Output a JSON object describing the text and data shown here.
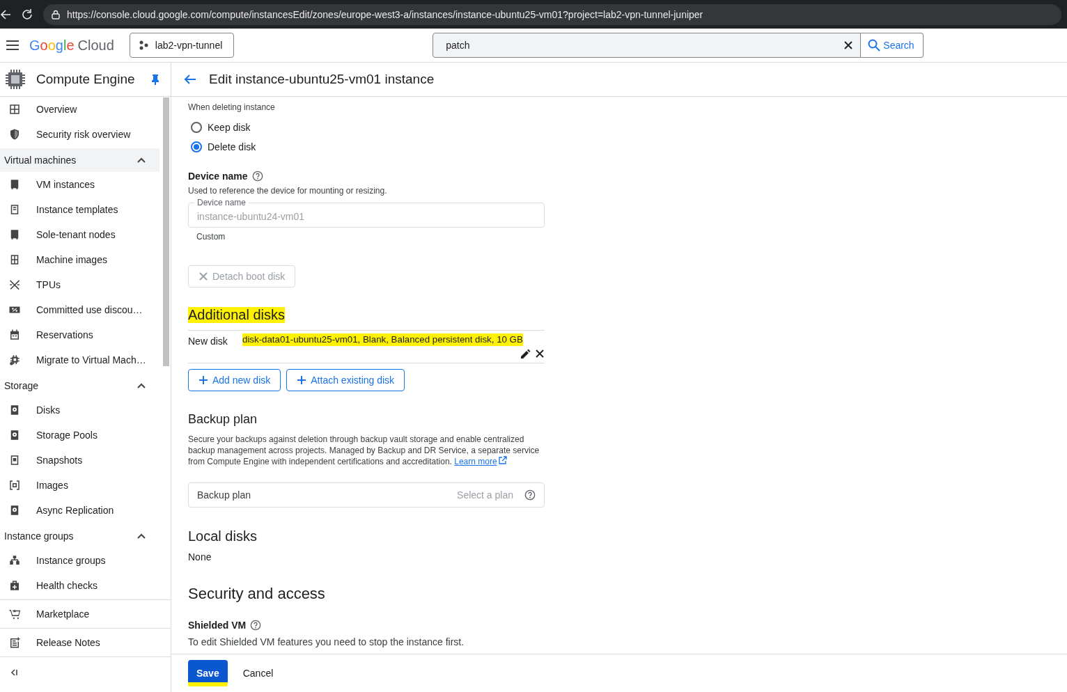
{
  "browser": {
    "url": "https://console.cloud.google.com/compute/instancesEdit/zones/europe-west3-a/instances/instance-ubuntu25-vm01?project=lab2-vpn-tunnel-juniper"
  },
  "topbar": {
    "logo_brand": "Google",
    "logo_product": "Cloud",
    "project": "lab2-vpn-tunnel",
    "search": {
      "value": "patch"
    },
    "search_button": "Search"
  },
  "sidebar": {
    "title": "Compute Engine",
    "groups": [
      {
        "items": [
          {
            "label": "Overview"
          },
          {
            "label": "Security risk overview"
          }
        ]
      },
      {
        "title": "Virtual machines",
        "expanded": true,
        "hovered": true,
        "items": [
          {
            "label": "VM instances"
          },
          {
            "label": "Instance templates"
          },
          {
            "label": "Sole-tenant nodes"
          },
          {
            "label": "Machine images"
          },
          {
            "label": "TPUs"
          },
          {
            "label": "Committed use discou…"
          },
          {
            "label": "Reservations"
          },
          {
            "label": "Migrate to Virtual Mach…"
          }
        ]
      },
      {
        "title": "Storage",
        "expanded": true,
        "hovered": false,
        "items": [
          {
            "label": "Disks"
          },
          {
            "label": "Storage Pools"
          },
          {
            "label": "Snapshots"
          },
          {
            "label": "Images"
          },
          {
            "label": "Async Replication"
          }
        ]
      },
      {
        "title": "Instance groups",
        "expanded": true,
        "hovered": false,
        "items": [
          {
            "label": "Instance groups"
          },
          {
            "label": "Health checks"
          }
        ]
      }
    ],
    "footer_items": [
      {
        "label": "Marketplace"
      },
      {
        "label": "Release Notes"
      }
    ]
  },
  "page": {
    "title": "Edit instance-ubuntu25-vm01 instance"
  },
  "delete_rule": {
    "label": "When deleting instance",
    "options": [
      {
        "label": "Keep disk",
        "selected": false
      },
      {
        "label": "Delete disk",
        "selected": true
      }
    ]
  },
  "device_name": {
    "title": "Device name",
    "helper": "Used to reference the device for mounting or resizing.",
    "field": {
      "label": "Device name",
      "value": "instance-ubuntu24-vm01",
      "disabled": true
    },
    "hint": "Custom"
  },
  "detach_button": {
    "label": "Detach boot disk",
    "disabled": true
  },
  "additional_disks": {
    "title": "Additional disks",
    "highlighted": true,
    "rows": [
      {
        "type": "New disk",
        "description": "disk-data01-ubuntu25-vm01, Blank, Balanced persistent disk, 10 GB",
        "highlighted": true
      }
    ],
    "buttons": [
      "Add new disk",
      "Attach existing disk"
    ]
  },
  "backup_plan": {
    "title": "Backup plan",
    "text": "Secure your backups against deletion through backup vault storage and enable centralized backup management across projects. Managed by Backup and DR Service, a separate service from Compute Engine with independent certifications and accreditation.",
    "link": "Learn more",
    "select": {
      "label": "Backup plan",
      "placeholder": "Select a plan"
    }
  },
  "local_disks": {
    "title": "Local disks",
    "value": "None"
  },
  "security": {
    "title": "Security and access",
    "subsections": [
      {
        "title": "Shielded VM",
        "text": "To edit Shielded VM features you need to stop the instance first."
      }
    ]
  },
  "footer": {
    "buttons": [
      {
        "label": "Save",
        "kind": "primary",
        "highlighted": true
      },
      {
        "label": "Cancel",
        "kind": "text",
        "highlighted": false
      }
    ]
  }
}
